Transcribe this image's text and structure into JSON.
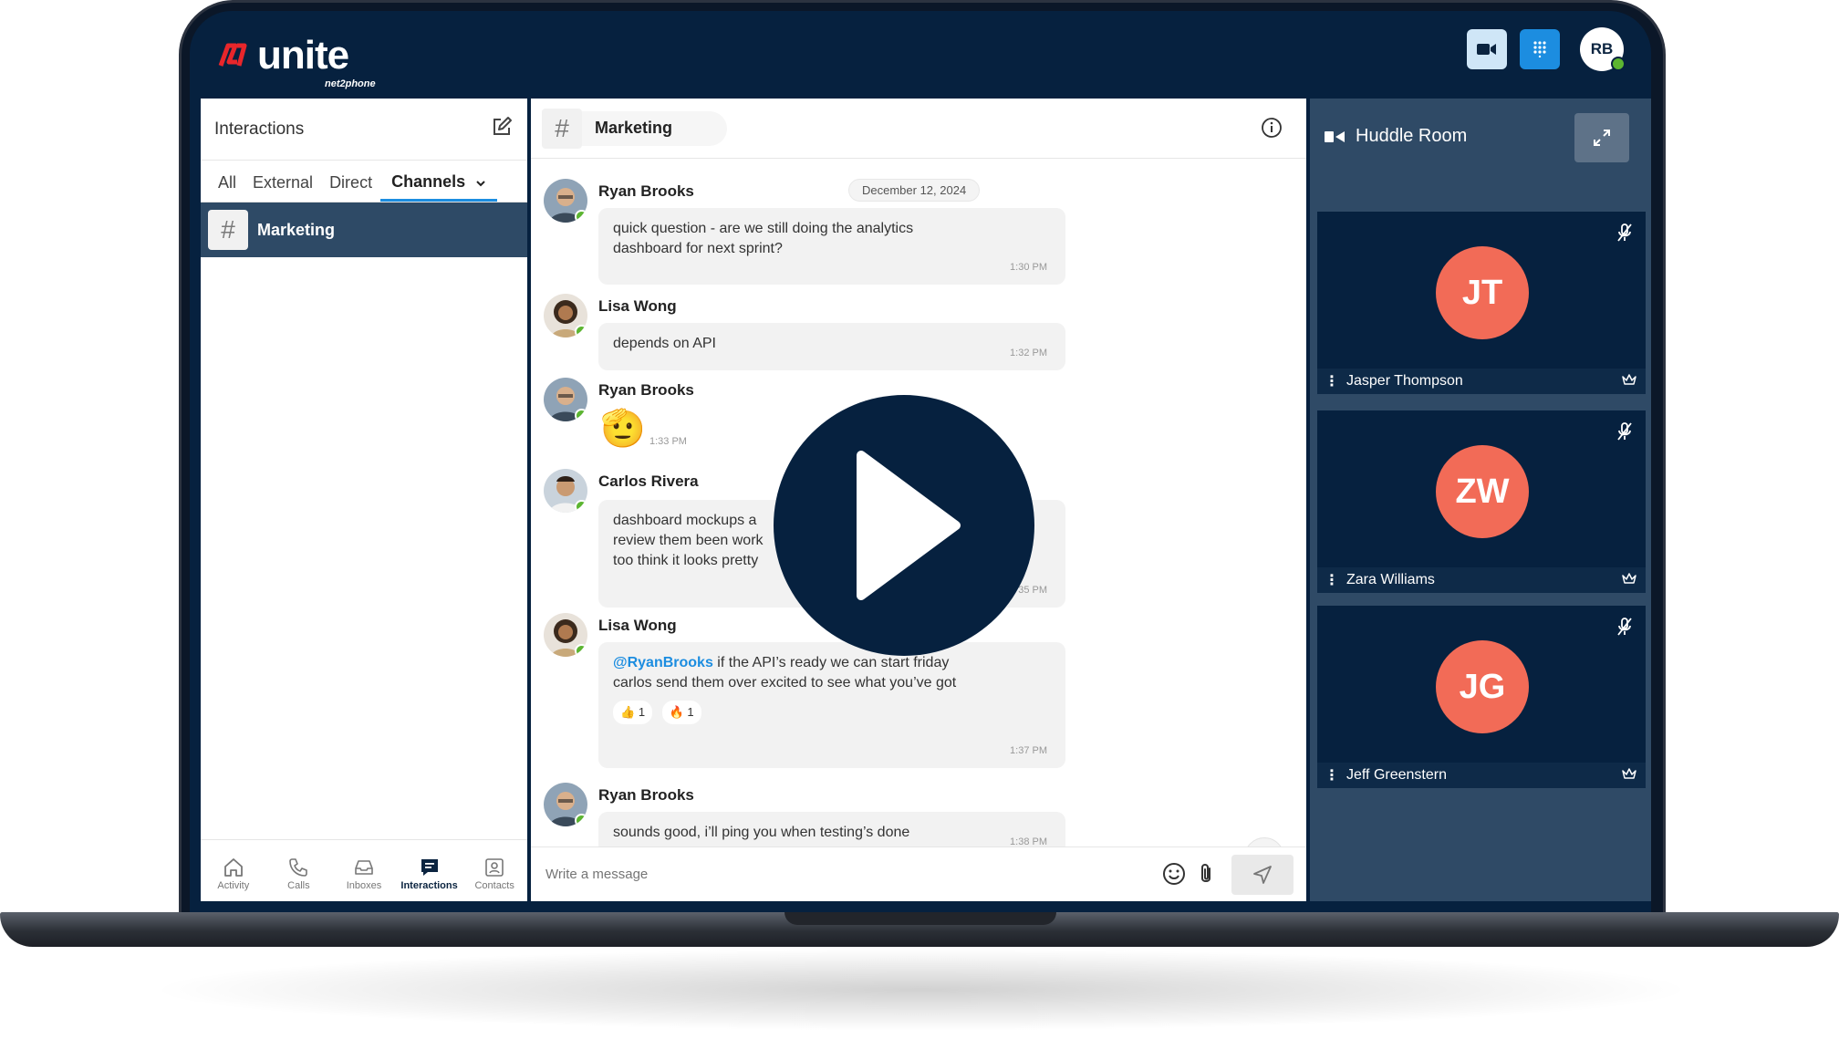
{
  "app": {
    "logo_word": "unite",
    "logo_sub": "net2phone",
    "user_initials": "RB"
  },
  "colors": {
    "navy": "#06213f",
    "accent_blue": "#1c8de0",
    "presence": "#5cb531",
    "avatar_orange": "#f26b57",
    "huddle_bg": "#2f4a66"
  },
  "left": {
    "title": "Interactions",
    "tabs": [
      "All",
      "External",
      "Direct",
      "Channels"
    ],
    "active_tab": "Channels",
    "channel": {
      "name": "Marketing"
    },
    "nav": [
      {
        "label": "Activity",
        "icon": "home-icon"
      },
      {
        "label": "Calls",
        "icon": "phone-icon"
      },
      {
        "label": "Inboxes",
        "icon": "inbox-icon"
      },
      {
        "label": "Interactions",
        "icon": "chat-icon"
      },
      {
        "label": "Contacts",
        "icon": "contacts-icon"
      }
    ]
  },
  "chat": {
    "channel_name": "Marketing",
    "date": "December 12, 2024",
    "messages": [
      {
        "sender": "Ryan Brooks",
        "text": "quick question - are we still doing the analytics dashboard for next sprint?",
        "time": "1:30 PM"
      },
      {
        "sender": "Lisa Wong",
        "text": "depends on API",
        "time": "1:32 PM"
      },
      {
        "sender": "Ryan Brooks",
        "text": "🫡",
        "time": "1:33 PM"
      },
      {
        "sender": "Carlos Rivera",
        "text": "dashboard mockups a review them been work too think it looks pretty",
        "time": "35 PM"
      },
      {
        "sender": "Lisa Wong",
        "mention": "@RyanBrooks",
        "text": " if the API’s ready we can start friday carlos send them over excited to see what you’ve got",
        "time": "1:37 PM",
        "reactions": [
          {
            "emoji": "👍",
            "count": "1"
          },
          {
            "emoji": "🔥",
            "count": "1"
          }
        ]
      },
      {
        "sender": "Ryan Brooks",
        "text": "sounds good, i’ll ping you when testing’s done",
        "time": "1:38 PM"
      }
    ],
    "composer_placeholder": "Write a message"
  },
  "huddle": {
    "title": "Huddle Room",
    "participants": [
      {
        "initials": "JT",
        "name": "Jasper Thompson"
      },
      {
        "initials": "ZW",
        "name": "Zara Williams"
      },
      {
        "initials": "JG",
        "name": "Jeff Greenstern"
      }
    ]
  }
}
